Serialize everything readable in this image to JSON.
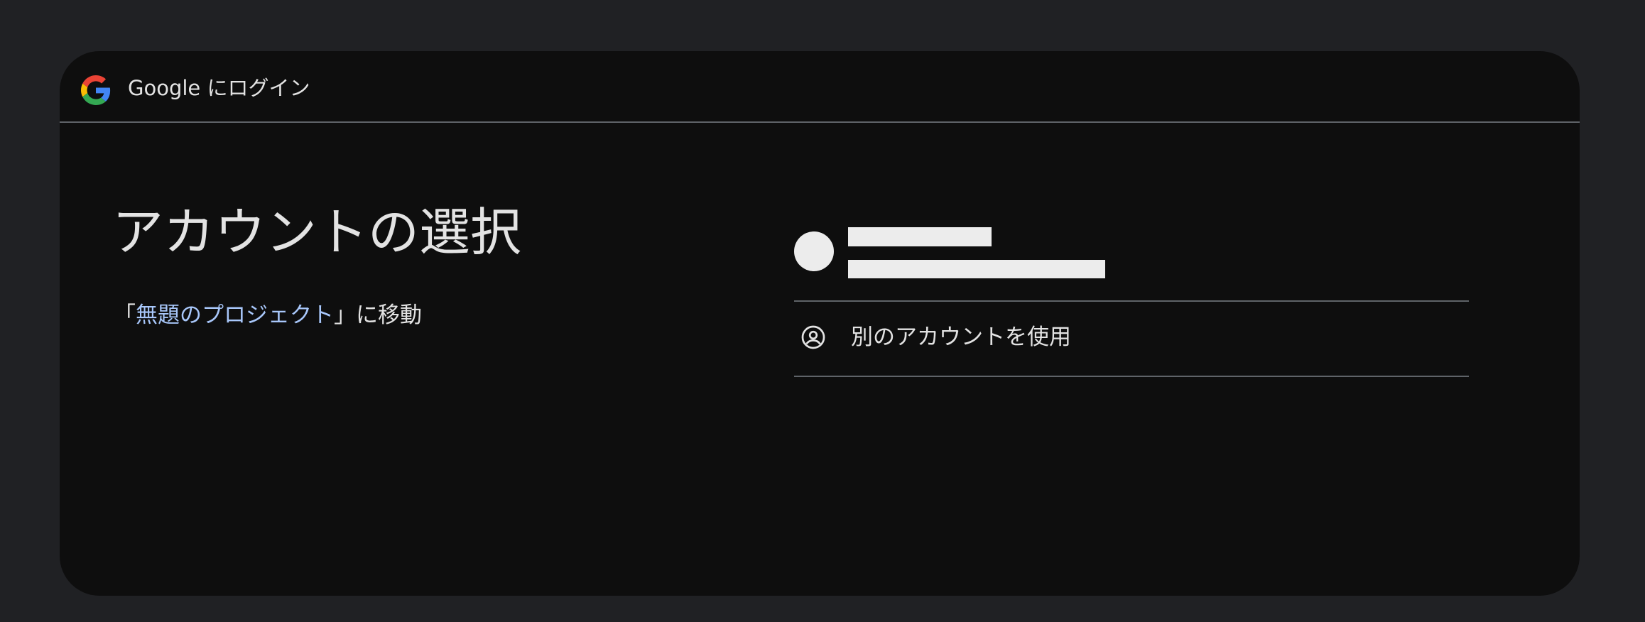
{
  "header": {
    "title": "Google にログイン",
    "logo_icon": "google-g-logo"
  },
  "main": {
    "title": "アカウントの選択",
    "subtitle_prefix": "「",
    "project_name": "無題のプロジェクト",
    "subtitle_suffix": "」に移動"
  },
  "accounts": [
    {
      "name": "",
      "email": ""
    }
  ],
  "other_account": {
    "label": "別のアカウントを使用",
    "icon": "account-circle-icon"
  },
  "colors": {
    "page_background": "#202124",
    "card_background": "#0e0e0e",
    "text": "#e3e3e3",
    "link": "#a8c7fa",
    "divider": "#5f6368",
    "redaction": "#ececec"
  }
}
